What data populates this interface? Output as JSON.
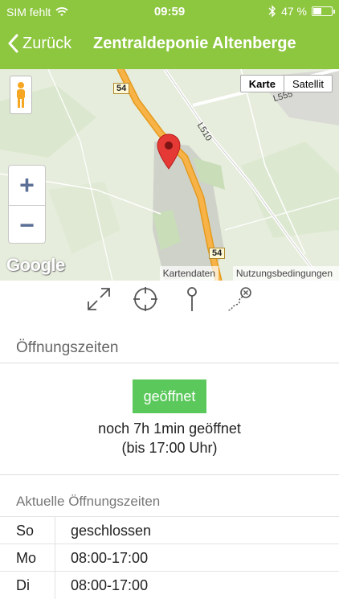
{
  "status_bar": {
    "carrier": "SIM fehlt",
    "time": "09:59",
    "battery_percent": "47 %",
    "battery_level": 0.47
  },
  "nav": {
    "back_label": "Zurück",
    "title": "Zentraldeponie Altenberge"
  },
  "map": {
    "type_map": "Karte",
    "type_satellite": "Satellit",
    "road_54": "54",
    "road_l510": "L510",
    "road_l555": "L555",
    "zoom_in": "+",
    "zoom_out": "−",
    "logo": "Google",
    "attribution_data": "Kartendaten",
    "attribution_terms": "Nutzungsbedingungen"
  },
  "tools": {
    "icons": [
      "fullscreen-icon",
      "locate-icon",
      "pin-icon",
      "route-icon"
    ]
  },
  "opening": {
    "heading": "Öffnungszeiten",
    "status": "geöffnet",
    "remaining": "noch 7h 1min geöffnet",
    "until": "(bis 17:00 Uhr)",
    "current_heading": "Aktuelle Öffnungszeiten",
    "rows": [
      {
        "day": "So",
        "time": "geschlossen"
      },
      {
        "day": "Mo",
        "time": "08:00-17:00"
      },
      {
        "day": "Di",
        "time": "08:00-17:00"
      }
    ]
  },
  "colors": {
    "brand_green": "#8dc63f",
    "open_green": "#5ac85a",
    "road_orange": "#f5a623",
    "pin_red": "#e53935"
  }
}
